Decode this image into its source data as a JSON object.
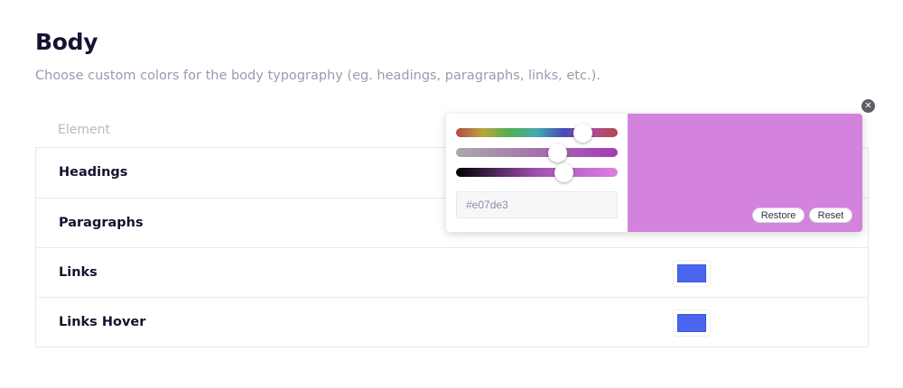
{
  "section": {
    "title": "Body",
    "subtitle": "Choose custom colors for the body typography (eg. headings, paragraphs, links, etc.)."
  },
  "table": {
    "column_element": "Element",
    "rows": [
      {
        "label": "Headings",
        "color": ""
      },
      {
        "label": "Paragraphs",
        "color": ""
      },
      {
        "label": "Links",
        "color": "#4a66ef"
      },
      {
        "label": "Links Hover",
        "color": "#4a66ef"
      }
    ]
  },
  "color_picker": {
    "hex_value": "#e07de3",
    "preview_color": "#d382dd",
    "restore_label": "Restore",
    "reset_label": "Reset",
    "close_icon": "close-icon"
  }
}
